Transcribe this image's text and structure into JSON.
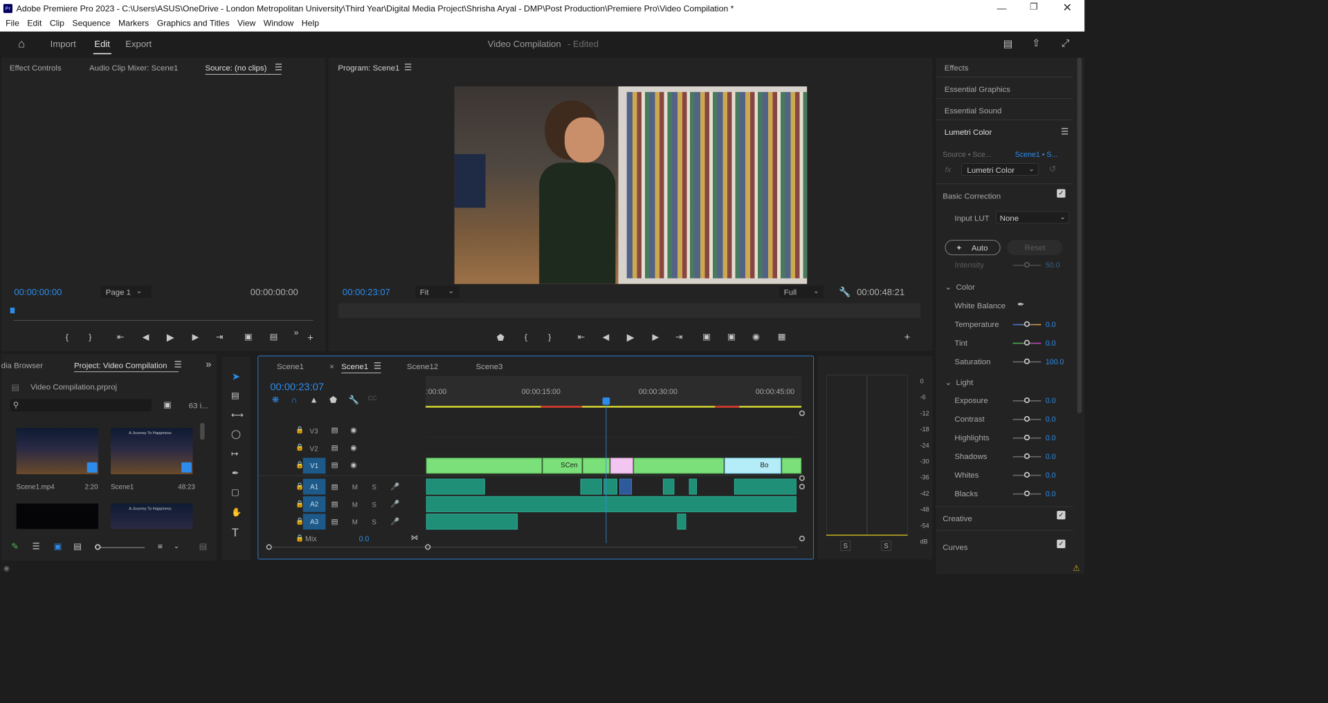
{
  "window": {
    "title": "Adobe Premiere Pro 2023 - C:\\Users\\ASUS\\OneDrive - London Metropolitan University\\Third Year\\Digital Media Project\\Shrisha Aryal - DMP\\Post Production\\Premiere Pro\\Video Compilation *",
    "app_icon": "Pr"
  },
  "menu": [
    "File",
    "Edit",
    "Clip",
    "Sequence",
    "Markers",
    "Graphics and Titles",
    "View",
    "Window",
    "Help"
  ],
  "header": {
    "tabs": [
      "Import",
      "Edit",
      "Export"
    ],
    "project_title": "Video Compilation",
    "status": "- Edited"
  },
  "source_panel": {
    "tabs": [
      "Effect Controls",
      "Audio Clip Mixer: Scene1",
      "Source: (no clips)"
    ],
    "timecode_left": "00:00:00:00",
    "page": "Page 1",
    "timecode_right": "00:00:00:00"
  },
  "program_panel": {
    "title": "Program: Scene1",
    "timecode": "00:00:23:07",
    "fit": "Fit",
    "quality": "Full",
    "duration": "00:00:48:21",
    "playhead_fraction": 0.476
  },
  "right_panel": {
    "items": [
      "Effects",
      "Essential Graphics",
      "Essential Sound",
      "Lumetri Color"
    ]
  },
  "lumetri": {
    "source_label": "Source • Sce...",
    "target_label": "Scene1 • S...",
    "effect": "Lumetri Color",
    "basic_correction": "Basic Correction",
    "input_lut_label": "Input LUT",
    "input_lut_value": "None",
    "auto": "Auto",
    "reset": "Reset",
    "intensity_label": "Intensity",
    "intensity_value": "50.0",
    "color_section": "Color",
    "white_balance": "White Balance",
    "light_section": "Light",
    "creative": "Creative",
    "curves": "Curves",
    "color_rows": [
      {
        "label": "Temperature",
        "value": "0.0",
        "pos": 0.5
      },
      {
        "label": "Tint",
        "value": "0.0",
        "pos": 0.5
      },
      {
        "label": "Saturation",
        "value": "100.0",
        "pos": 0.5
      }
    ],
    "light_rows": [
      {
        "label": "Exposure",
        "value": "0.0",
        "pos": 0.5
      },
      {
        "label": "Contrast",
        "value": "0.0",
        "pos": 0.5
      },
      {
        "label": "Highlights",
        "value": "0.0",
        "pos": 0.5
      },
      {
        "label": "Shadows",
        "value": "0.0",
        "pos": 0.5
      },
      {
        "label": "Whites",
        "value": "0.0",
        "pos": 0.5
      },
      {
        "label": "Blacks",
        "value": "0.0",
        "pos": 0.5
      }
    ]
  },
  "project_panel": {
    "tabs": [
      "dia Browser",
      "Project: Video Compilation"
    ],
    "file": "Video Compilation.prproj",
    "count": "63 i...",
    "items": [
      {
        "name": "Scene1.mp4",
        "duration": "2:20"
      },
      {
        "name": "Scene1",
        "duration": "48:23"
      }
    ],
    "thumb_text": "A Journey To Happiness"
  },
  "timeline": {
    "tabs": [
      "Scene1",
      "Scene1",
      "Scene12",
      "Scene3"
    ],
    "timecode": "00:00:23:07",
    "ruler": [
      ":00:00",
      "00:00:15:00",
      "00:00:30:00",
      "00:00:45:00"
    ],
    "video_tracks": [
      "V3",
      "V2",
      "V1"
    ],
    "audio_tracks": [
      "A1",
      "A2",
      "A3"
    ],
    "mix_label": "Mix",
    "mix_value": "0.0",
    "clip_label_1": "SCen",
    "clip_label_2": "Bo",
    "track_buttons": {
      "mute": "M",
      "solo": "S"
    }
  },
  "meter": {
    "scale": [
      "0",
      "-6",
      "-12",
      "-18",
      "-24",
      "-30",
      "-36",
      "-42",
      "-48",
      "-54",
      "dB"
    ],
    "solo_left": "S",
    "solo_right": "S"
  }
}
